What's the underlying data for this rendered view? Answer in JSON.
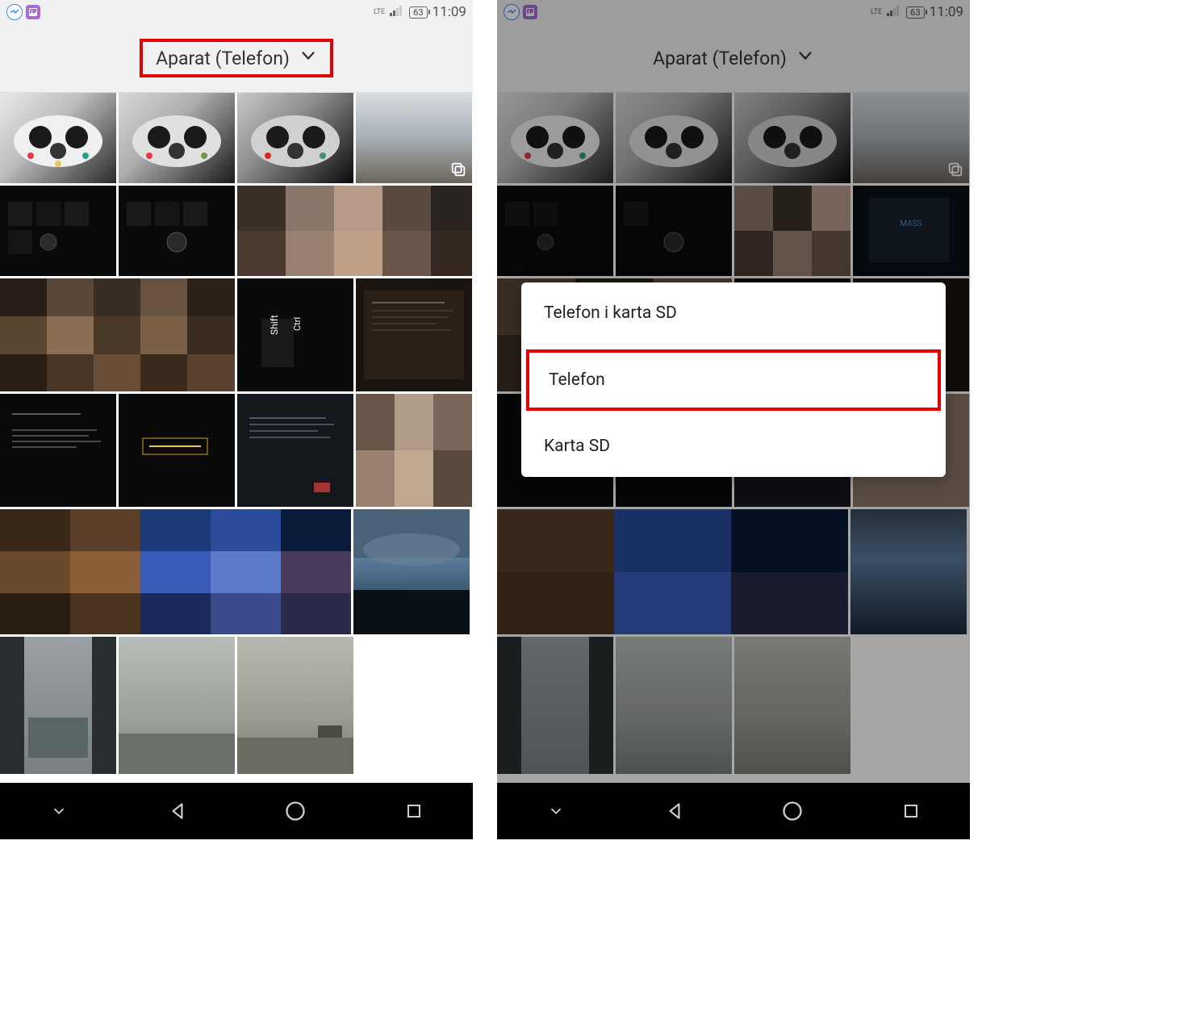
{
  "status": {
    "lte": "LTE",
    "battery": "63",
    "time": "11:09"
  },
  "header": {
    "title": "Aparat (Telefon)"
  },
  "menu": {
    "items": [
      {
        "label": "Telefon i karta SD"
      },
      {
        "label": "Telefon"
      },
      {
        "label": "Karta SD"
      }
    ]
  }
}
